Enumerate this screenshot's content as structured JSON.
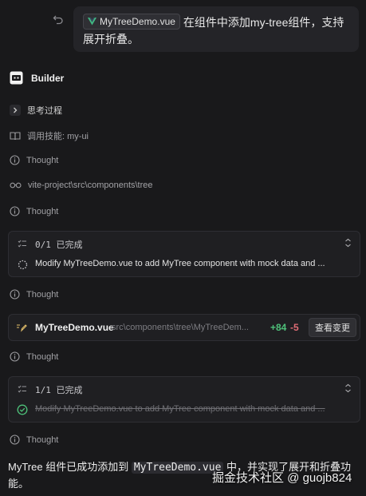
{
  "user_message": {
    "file_chip": "MyTreeDemo.vue",
    "text": "在组件中添加my-tree组件，支持展开折叠。"
  },
  "assistant": {
    "name": "Builder"
  },
  "steps": {
    "thinking_label": "思考过程",
    "skill_call": "调用技能: my-ui",
    "thought": "Thought",
    "path": "vite-project\\src\\components\\tree"
  },
  "task_card_1": {
    "progress": "0/1 已完成",
    "task": "Modify MyTreeDemo.vue to add MyTree component with mock data and ..."
  },
  "file_change": {
    "filename": "MyTreeDemo.vue",
    "path": "src\\components\\tree\\MyTreeDem...",
    "additions": "+84",
    "deletions": "-5",
    "button": "查看变更"
  },
  "task_card_2": {
    "progress": "1/1 已完成",
    "task": "Modify MyTreeDemo.vue to add MyTree component with mock data and ..."
  },
  "final_message": {
    "prefix": "MyTree 组件已成功添加到",
    "code": "MyTreeDemo.vue",
    "suffix": "中，并实现了展开和折叠功能。"
  },
  "watermark": "掘金技术社区 @ guojb824",
  "colors": {
    "background": "#19191b",
    "additions": "#4ec27a",
    "deletions": "#e06c75",
    "vue_green": "#41b883"
  }
}
